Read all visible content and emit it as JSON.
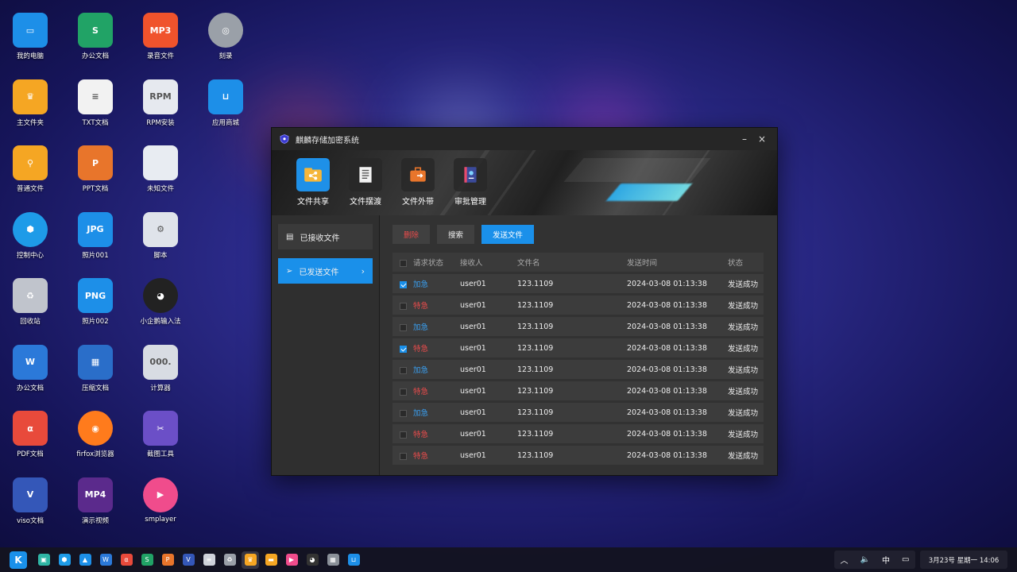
{
  "desktop": {
    "icons": [
      {
        "label": "我的电脑",
        "icon": "computer-icon",
        "color": "#1d8fe8"
      },
      {
        "label": "主文件夹",
        "icon": "home-folder-icon",
        "color": "#f5a623"
      },
      {
        "label": "普通文件",
        "icon": "folder-icon",
        "color": "#f5a623"
      },
      {
        "label": "控制中心",
        "icon": "control-center-icon",
        "color": "#1e9be8"
      },
      {
        "label": "回收站",
        "icon": "trash-icon",
        "color": "#c0c4cc"
      },
      {
        "label": "办公文档",
        "icon": "word-doc-icon",
        "color": "#2b79d9"
      },
      {
        "label": "PDF文档",
        "icon": "pdf-icon",
        "color": "#e84a3b"
      },
      {
        "label": "viso文档",
        "icon": "visio-icon",
        "color": "#3457b8"
      },
      {
        "label": "办公文档",
        "icon": "spreadsheet-icon",
        "color": "#21a366"
      },
      {
        "label": "TXT文档",
        "icon": "txt-doc-icon",
        "color": "#f2f2f2"
      },
      {
        "label": "PPT文档",
        "icon": "ppt-icon",
        "color": "#e8752b"
      },
      {
        "label": "照片001",
        "icon": "jpg-image-icon",
        "color": "#1d8fe8"
      },
      {
        "label": "照片002",
        "icon": "png-image-icon",
        "color": "#1d8fe8"
      },
      {
        "label": "压缩文档",
        "icon": "archive-icon",
        "color": "#2a6ec9"
      },
      {
        "label": "firfox浏览器",
        "icon": "firefox-icon",
        "color": "#ff7b1c"
      },
      {
        "label": "演示视频",
        "icon": "mp4-video-icon",
        "color": "#5b2a8c"
      },
      {
        "label": "录音文件",
        "icon": "mp3-audio-icon",
        "color": "#f0532c"
      },
      {
        "label": "RPM安装",
        "icon": "rpm-package-icon",
        "color": "#e6e9ef"
      },
      {
        "label": "未知文件",
        "icon": "unknown-file-icon",
        "color": "#e8ecf2"
      },
      {
        "label": "脚本",
        "icon": "script-icon",
        "color": "#dfe3ea"
      },
      {
        "label": "小企鹅输入法",
        "icon": "penguin-ime-icon",
        "color": "#222222"
      },
      {
        "label": "计算器",
        "icon": "calculator-icon",
        "color": "#d8dce3"
      },
      {
        "label": "截图工具",
        "icon": "screenshot-tool-icon",
        "color": "#6b4fc7"
      },
      {
        "label": "smplayer",
        "icon": "smplayer-icon",
        "color": "#f04c8c"
      },
      {
        "label": "刻录",
        "icon": "burner-icon",
        "color": "#9aa0a8"
      },
      {
        "label": "应用商城",
        "icon": "app-store-icon",
        "color": "#1d8fe8"
      }
    ],
    "icon_glyphs": {
      "MP3": "MP3",
      "RPM": "RPM",
      "JPG": "JPG",
      "PNG": "PNG",
      "MP4": "MP4",
      "P": "P",
      "S": "S",
      "W": "W",
      "V": "V",
      "calc": "000."
    }
  },
  "window": {
    "title": "麒麟存储加密系统",
    "minimize": "–",
    "close": "×",
    "nav": [
      {
        "label": "文件共享",
        "icon": "file-share-icon",
        "active": true
      },
      {
        "label": "文件摆渡",
        "icon": "file-ferry-icon",
        "active": false
      },
      {
        "label": "文件外带",
        "icon": "file-carry-out-icon",
        "active": false
      },
      {
        "label": "审批管理",
        "icon": "approval-management-icon",
        "active": false
      }
    ],
    "sidebar": {
      "received": "已接收文件",
      "sent": "已发送文件"
    },
    "toolbar": {
      "delete": "删除",
      "search": "搜索",
      "send": "发送文件"
    },
    "table": {
      "headers": [
        "请求状态",
        "接收人",
        "文件名",
        "发送时间",
        "状态"
      ],
      "rows": [
        {
          "checked": true,
          "priority": "加急",
          "priority_color": "#3a9ff0",
          "receiver": "user01",
          "file": "123.1109",
          "time": "2024-03-08  01:13:38",
          "status": "发送成功"
        },
        {
          "checked": false,
          "priority": "特急",
          "priority_color": "#e94b4b",
          "receiver": "user01",
          "file": "123.1109",
          "time": "2024-03-08  01:13:38",
          "status": "发送成功"
        },
        {
          "checked": false,
          "priority": "加急",
          "priority_color": "#3a9ff0",
          "receiver": "user01",
          "file": "123.1109",
          "time": "2024-03-08  01:13:38",
          "status": "发送成功"
        },
        {
          "checked": true,
          "priority": "特急",
          "priority_color": "#e94b4b",
          "receiver": "user01",
          "file": "123.1109",
          "time": "2024-03-08  01:13:38",
          "status": "发送成功"
        },
        {
          "checked": false,
          "priority": "加急",
          "priority_color": "#3a9ff0",
          "receiver": "user01",
          "file": "123.1109",
          "time": "2024-03-08  01:13:38",
          "status": "发送成功"
        },
        {
          "checked": false,
          "priority": "特急",
          "priority_color": "#e94b4b",
          "receiver": "user01",
          "file": "123.1109",
          "time": "2024-03-08  01:13:38",
          "status": "发送成功"
        },
        {
          "checked": false,
          "priority": "加急",
          "priority_color": "#3a9ff0",
          "receiver": "user01",
          "file": "123.1109",
          "time": "2024-03-08  01:13:38",
          "status": "发送成功"
        },
        {
          "checked": false,
          "priority": "特急",
          "priority_color": "#e94b4b",
          "receiver": "user01",
          "file": "123.1109",
          "time": "2024-03-08  01:13:38",
          "status": "发送成功"
        },
        {
          "checked": false,
          "priority": "特急",
          "priority_color": "#e94b4b",
          "receiver": "user01",
          "file": "123.1109",
          "time": "2024-03-08  01:13:38",
          "status": "发送成功"
        }
      ]
    }
  },
  "taskbar": {
    "start": "K",
    "apps": [
      {
        "icon": "desktop-icon",
        "color": "#2fb5a5"
      },
      {
        "icon": "control-center-icon",
        "color": "#1e9be8"
      },
      {
        "icon": "png-image-icon",
        "color": "#1d8fe8"
      },
      {
        "icon": "word-doc-icon",
        "color": "#2b79d9"
      },
      {
        "icon": "pdf-icon",
        "color": "#e84a3b"
      },
      {
        "icon": "spreadsheet-icon",
        "color": "#21a366"
      },
      {
        "icon": "ppt-icon",
        "color": "#e8752b"
      },
      {
        "icon": "visio-icon",
        "color": "#3457b8"
      },
      {
        "icon": "txt-doc-icon",
        "color": "#cfd3da"
      },
      {
        "icon": "trash-icon",
        "color": "#9aa0a8"
      },
      {
        "icon": "home-folder-icon",
        "color": "#f5a623"
      },
      {
        "icon": "folder-icon",
        "color": "#f5a623"
      },
      {
        "icon": "smplayer-icon",
        "color": "#f04c8c"
      },
      {
        "icon": "penguin-ime-icon",
        "color": "#333333"
      },
      {
        "icon": "calculator-icon",
        "color": "#8a9099"
      },
      {
        "icon": "app-store-icon",
        "color": "#1d8fe8"
      }
    ],
    "tray": {
      "up": "︿",
      "volume": "🔈",
      "ime": "中",
      "display": "▭"
    },
    "clock": "3月23号 星期一 14:06"
  }
}
